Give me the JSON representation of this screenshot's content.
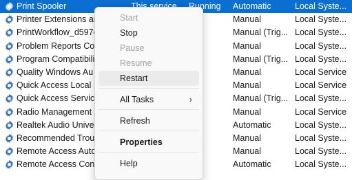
{
  "services": [
    {
      "name": "Print Spooler",
      "description": "This service",
      "status": "Running",
      "startup": "Automatic",
      "logon": "Local Syste...",
      "selected": true
    },
    {
      "name": "Printer Extensions an",
      "description": "",
      "status": "",
      "startup": "Manual",
      "logon": "Local Syste..."
    },
    {
      "name": "PrintWorkflow_d597c",
      "description": "",
      "status": "",
      "startup": "Manual (Trig...",
      "logon": "Local Syste..."
    },
    {
      "name": "Problem Reports Con",
      "description": "",
      "status": "",
      "startup": "Manual",
      "logon": "Local Syste..."
    },
    {
      "name": "Program Compatibili",
      "description": "",
      "status": "",
      "startup": "Manual (Trig...",
      "logon": "Local Syste..."
    },
    {
      "name": "Quality Windows Au",
      "description": "",
      "status": "",
      "startup": "Manual",
      "logon": "Local Service"
    },
    {
      "name": "Quick Access Local S",
      "description": "",
      "status": "",
      "startup": "Manual",
      "logon": "Local Service"
    },
    {
      "name": "Quick Access Service",
      "description": "",
      "status": "",
      "startup": "Manual (Trig...",
      "logon": "Local Syste..."
    },
    {
      "name": "Radio Management S",
      "description": "",
      "status": "",
      "startup": "Manual",
      "logon": "Local Service"
    },
    {
      "name": "Realtek Audio Univer",
      "description": "",
      "status": "",
      "startup": "Automatic",
      "logon": "Local Syste..."
    },
    {
      "name": "Recommended Troub",
      "description": "",
      "status": "",
      "startup": "Manual",
      "logon": "Local Syste..."
    },
    {
      "name": "Remote Access Auto",
      "description": "",
      "status": "",
      "startup": "Manual",
      "logon": "Local Syste..."
    },
    {
      "name": "Remote Access Conn",
      "description": "",
      "status": "",
      "startup": "Automatic",
      "logon": "Local Syste..."
    }
  ],
  "context_menu": {
    "items": [
      {
        "label": "Start",
        "disabled": true
      },
      {
        "label": "Stop",
        "disabled": false
      },
      {
        "label": "Pause",
        "disabled": true
      },
      {
        "label": "Resume",
        "disabled": true
      },
      {
        "label": "Restart",
        "disabled": false,
        "hover": true
      },
      {
        "label": "All Tasks",
        "disabled": false,
        "submenu": true
      },
      {
        "label": "Refresh",
        "disabled": false
      },
      {
        "label": "Properties",
        "disabled": false,
        "bold": true
      },
      {
        "label": "Help",
        "disabled": false
      }
    ],
    "submenu_arrow": "›"
  },
  "colors": {
    "selection": "#0a6fd0",
    "gear": "#3f78b8"
  },
  "icons": {
    "service": "gear-icon"
  }
}
